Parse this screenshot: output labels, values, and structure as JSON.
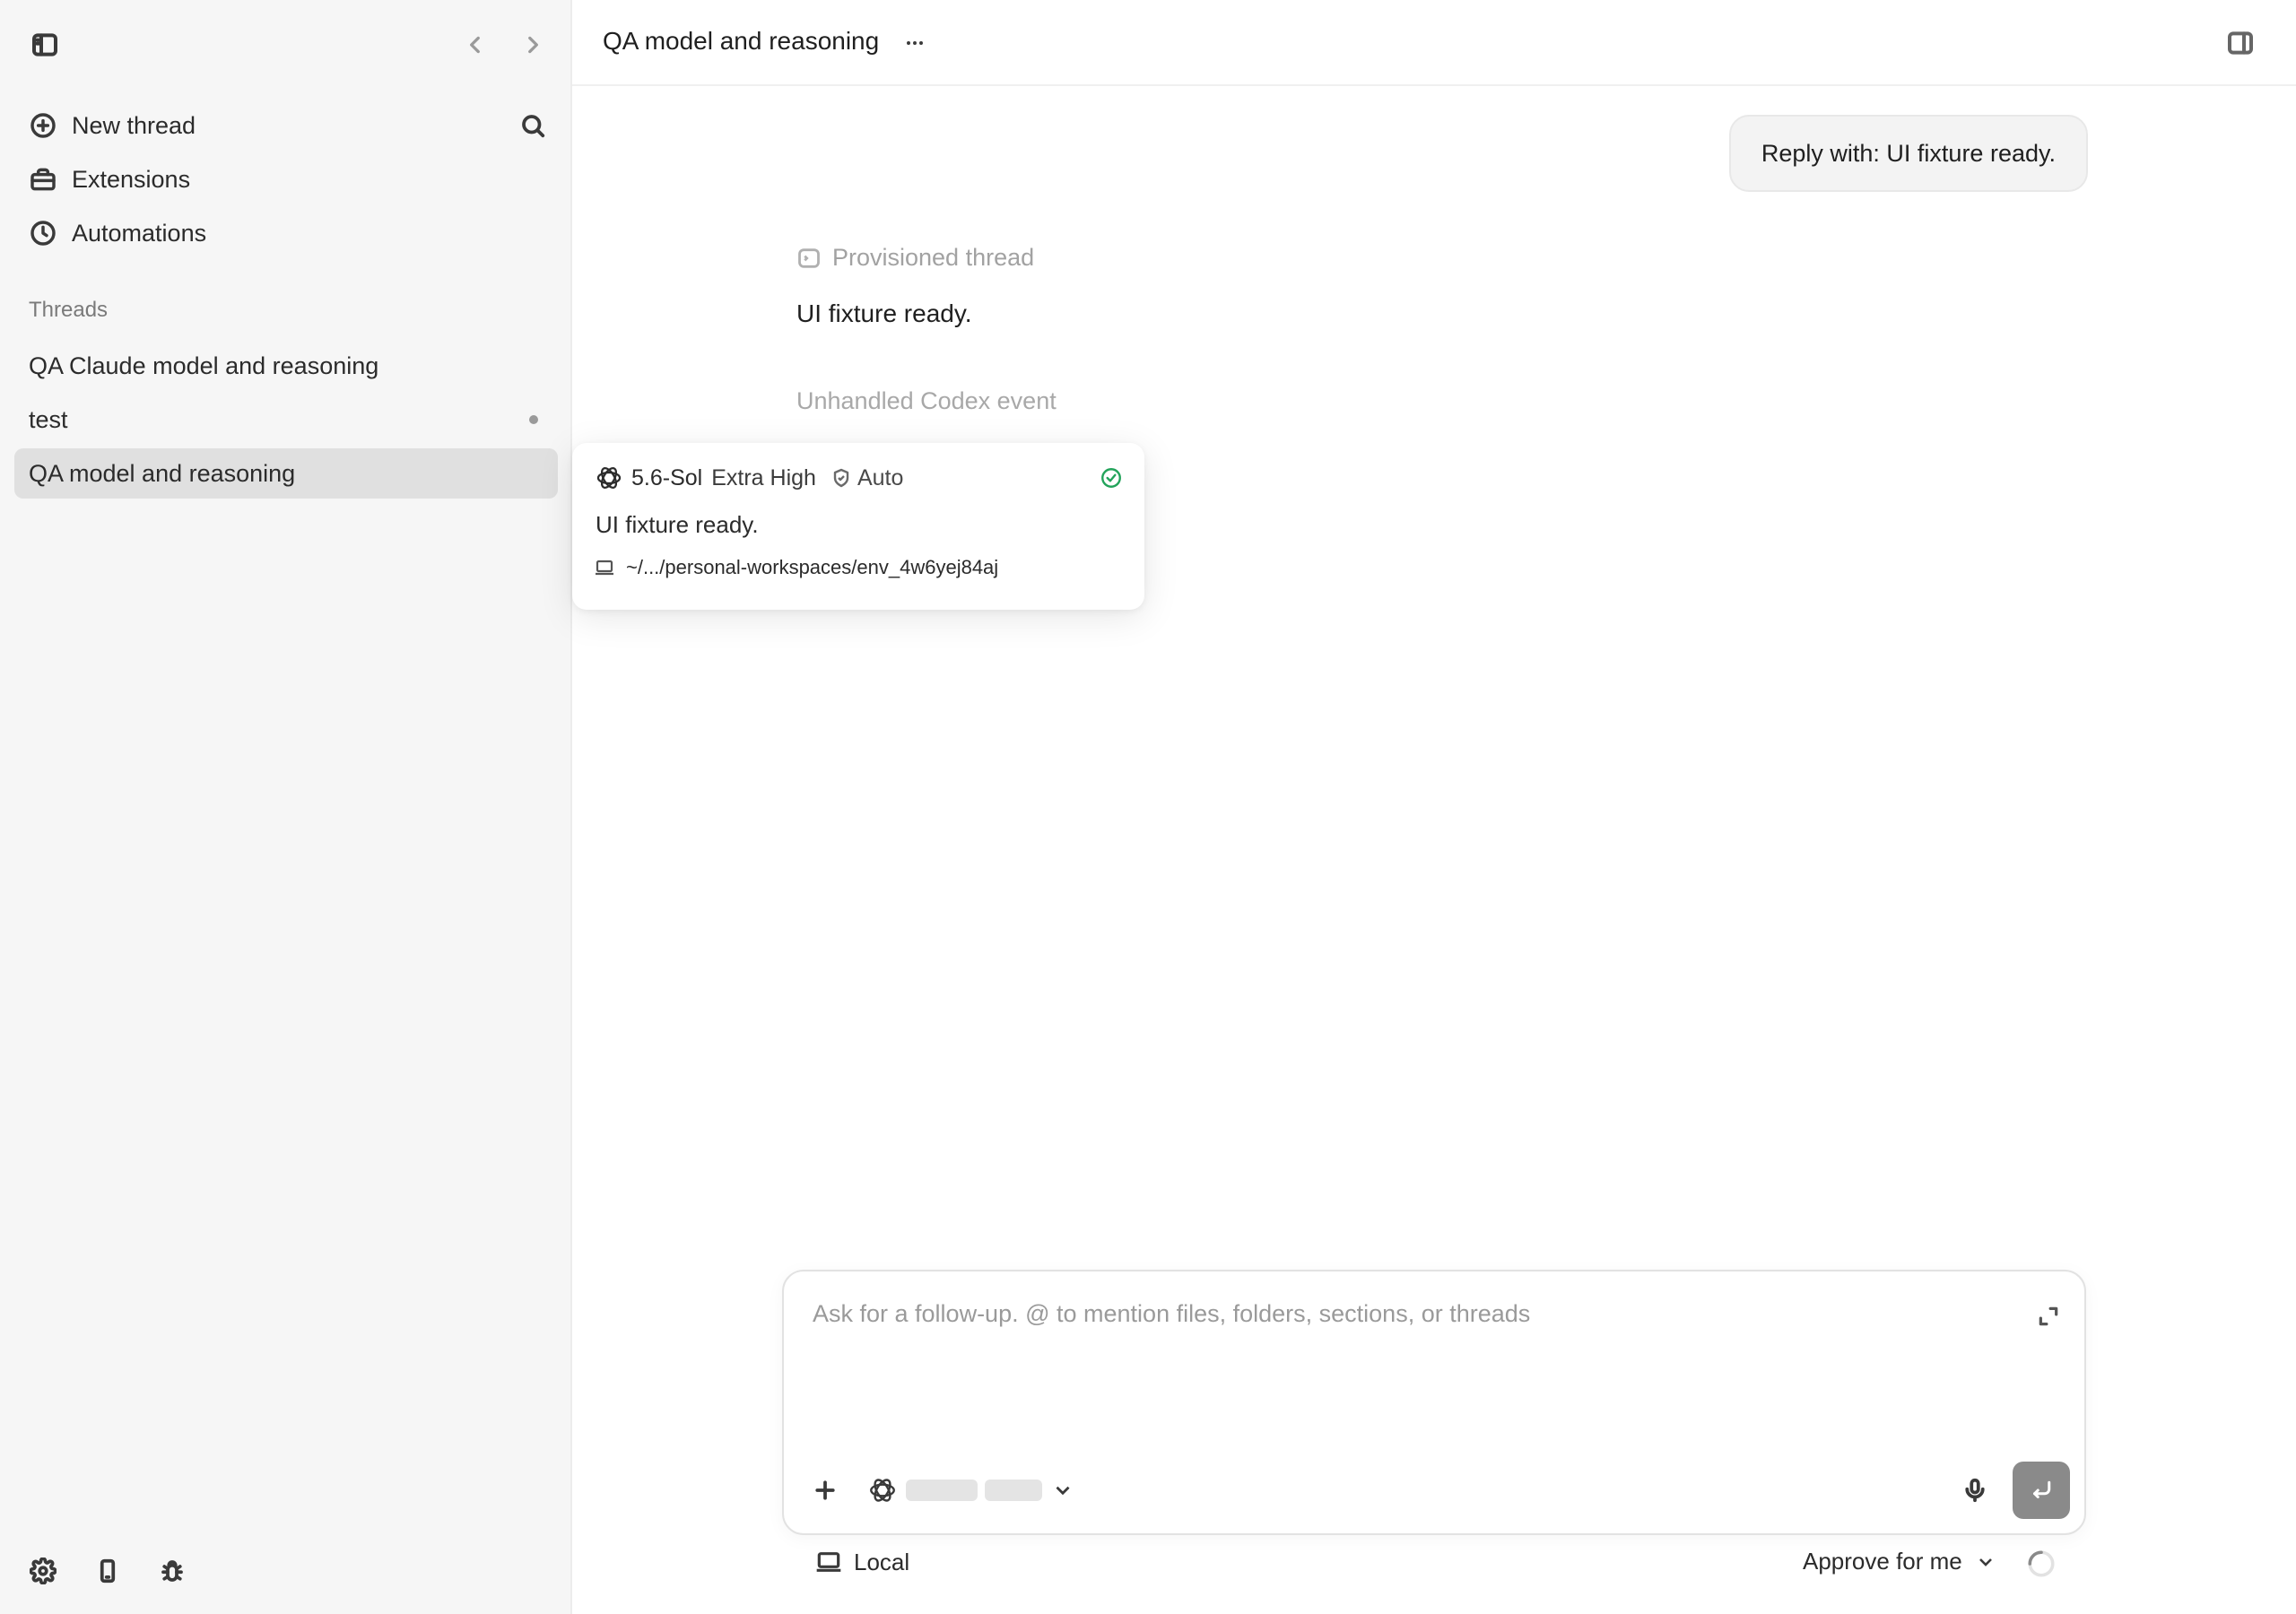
{
  "sidebar": {
    "actions": [
      {
        "label": "New thread",
        "icon": "plus-circle-icon"
      },
      {
        "label": "Extensions",
        "icon": "toolbox-icon"
      },
      {
        "label": "Automations",
        "icon": "clock-icon"
      }
    ],
    "threads_label": "Threads",
    "threads": [
      {
        "title": "QA Claude model and reasoning",
        "active": false,
        "unread": false
      },
      {
        "title": "test",
        "active": false,
        "unread": true
      },
      {
        "title": "QA model and reasoning",
        "active": true,
        "unread": false
      }
    ],
    "footer_icons": [
      "settings-icon",
      "phone-icon",
      "bug-icon"
    ]
  },
  "header": {
    "title": "QA model and reasoning",
    "more_icon": "ellipsis-icon"
  },
  "conversation": {
    "user_message": "Reply with: UI fixture ready.",
    "provisioned_label": "Provisioned thread",
    "assistant_message": "UI fixture ready.",
    "unhandled_event": "Unhandled Codex event"
  },
  "popover": {
    "model": "5.6-Sol",
    "effort": "Extra High",
    "mode": "Auto",
    "status_color": "#22a35a",
    "text": "UI fixture ready.",
    "path": "~/.../personal-workspaces/env_4w6yej84aj"
  },
  "composer": {
    "placeholder": "Ask for a follow-up. @ to mention files, folders, sections, or threads",
    "value": ""
  },
  "footer": {
    "environment": "Local",
    "approval": "Approve for me"
  },
  "colors": {
    "sidebar_bg": "#f6f6f6",
    "active_thread_bg": "#e0e0e0",
    "send_button": "#8a8a8a",
    "success": "#22a35a"
  }
}
